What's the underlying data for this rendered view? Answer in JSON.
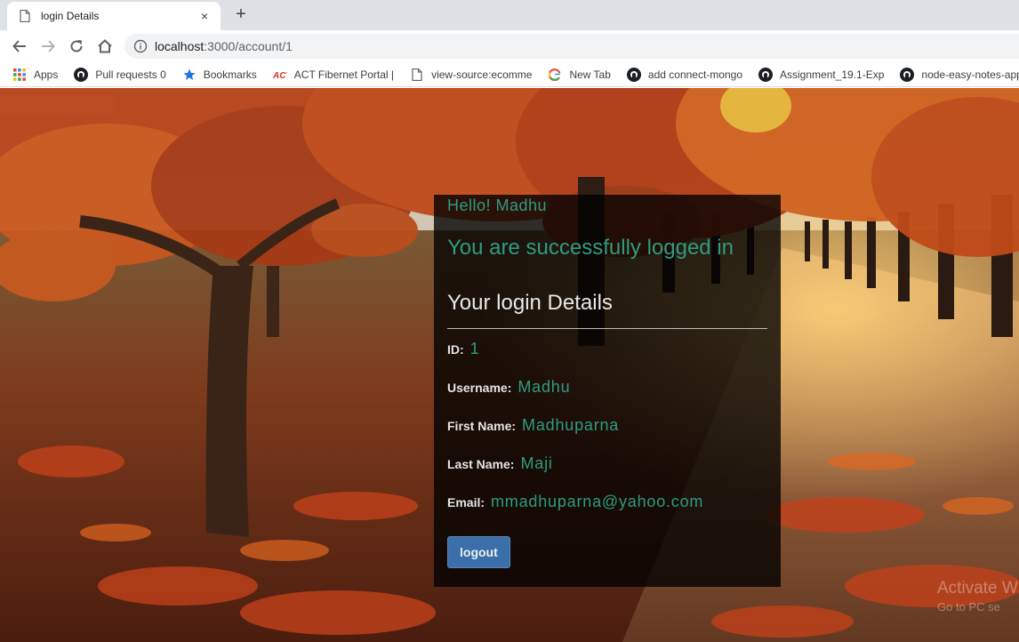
{
  "browser": {
    "tab_title": "login Details",
    "tab_close": "×",
    "new_tab": "+",
    "url_host": "localhost",
    "url_path": ":3000/account/1"
  },
  "bookmarks": [
    {
      "label": "Apps",
      "icon": "apps-grid-icon"
    },
    {
      "label": "Pull requests 0",
      "icon": "github-icon"
    },
    {
      "label": "Bookmarks",
      "icon": "star-icon"
    },
    {
      "label": "ACT Fibernet Portal |",
      "icon": "act-logo-icon"
    },
    {
      "label": "view-source:ecomme",
      "icon": "page-icon"
    },
    {
      "label": "New Tab",
      "icon": "google-icon"
    },
    {
      "label": "add connect-mongo",
      "icon": "github-icon"
    },
    {
      "label": "Assignment_19.1-Exp",
      "icon": "github-icon"
    },
    {
      "label": "node-easy-notes-app",
      "icon": "github-icon"
    }
  ],
  "card": {
    "hello": "Hello! Madhu",
    "success": "You are successfully logged in",
    "details_title": "Your login Details",
    "fields": [
      {
        "label": "ID:",
        "value": "1"
      },
      {
        "label": "Username:",
        "value": "Madhu"
      },
      {
        "label": "First Name:",
        "value": "Madhuparna"
      },
      {
        "label": "Last Name:",
        "value": "Maji"
      },
      {
        "label": "Email:",
        "value": "mmadhuparna@yahoo.com"
      }
    ],
    "logout_label": "logout"
  },
  "watermark": {
    "line1": "Activate W",
    "line2": "Go to PC se"
  },
  "colors": {
    "accent_green": "#2e9c82",
    "button_blue": "#3a6faa"
  }
}
